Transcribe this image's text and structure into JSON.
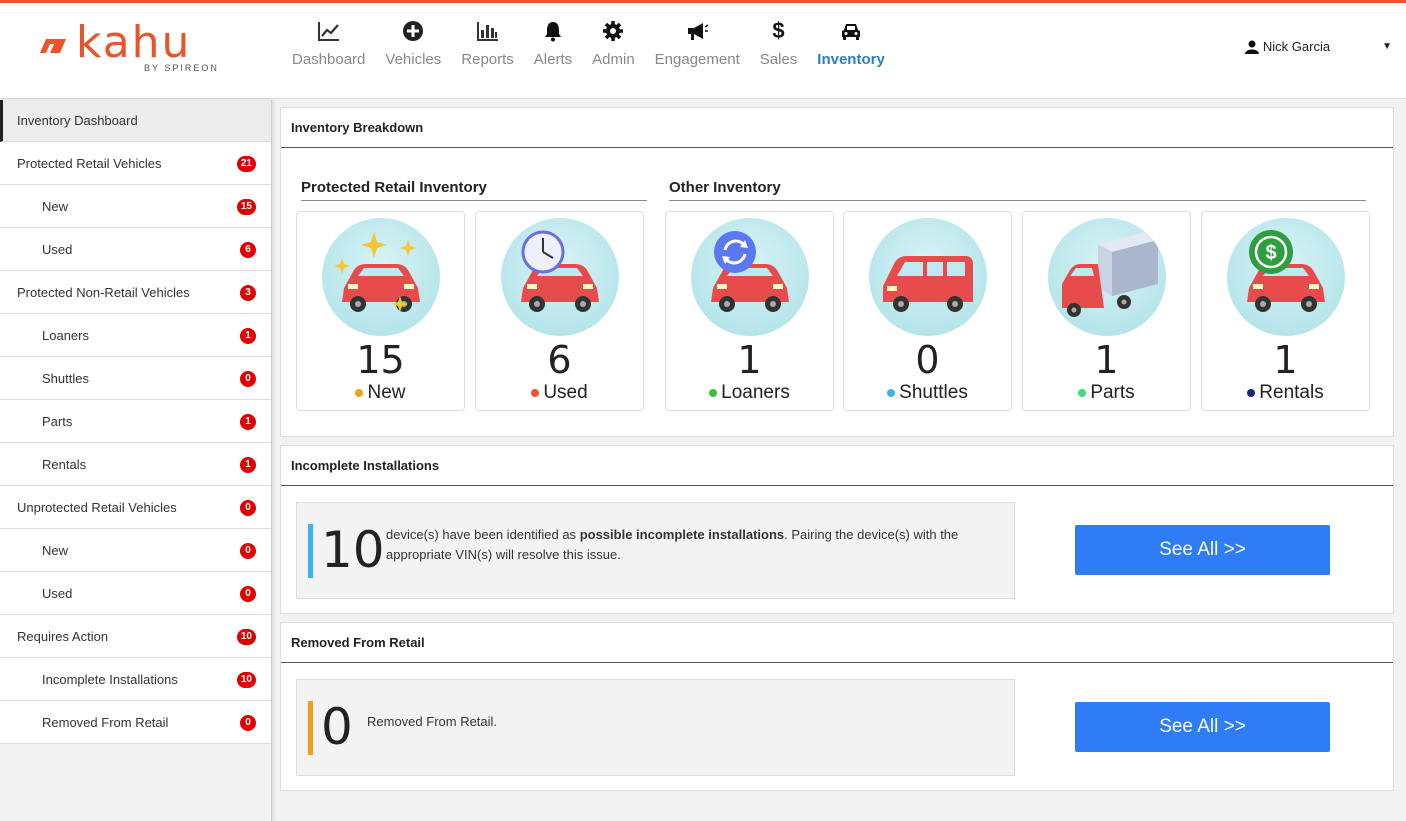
{
  "logo": {
    "word": "kahu",
    "by": "BY SPIREON"
  },
  "nav": [
    {
      "label": "Dashboard",
      "icon": "chart-line-icon"
    },
    {
      "label": "Vehicles",
      "icon": "plus-circle-icon"
    },
    {
      "label": "Reports",
      "icon": "bar-chart-icon"
    },
    {
      "label": "Alerts",
      "icon": "bell-icon"
    },
    {
      "label": "Admin",
      "icon": "gear-icon"
    },
    {
      "label": "Engagement",
      "icon": "megaphone-icon"
    },
    {
      "label": "Sales",
      "icon": "dollar-icon"
    },
    {
      "label": "Inventory",
      "icon": "car-icon",
      "active": true
    }
  ],
  "user": {
    "name": "Nick Garcia"
  },
  "sidebar": {
    "items": [
      {
        "label": "Inventory Dashboard",
        "badge": ""
      },
      {
        "label": "Protected Retail Vehicles",
        "badge": "21"
      },
      {
        "label": "New",
        "badge": "15"
      },
      {
        "label": "Used",
        "badge": "6"
      },
      {
        "label": "Protected Non-Retail Vehicles",
        "badge": "3"
      },
      {
        "label": "Loaners",
        "badge": "1"
      },
      {
        "label": "Shuttles",
        "badge": "0"
      },
      {
        "label": "Parts",
        "badge": "1"
      },
      {
        "label": "Rentals",
        "badge": "1"
      },
      {
        "label": "Unprotected Retail Vehicles",
        "badge": "0"
      },
      {
        "label": "New",
        "badge": "0"
      },
      {
        "label": "Used",
        "badge": "0"
      },
      {
        "label": "Requires Action",
        "badge": "10"
      },
      {
        "label": "Incomplete Installations",
        "badge": "10"
      },
      {
        "label": "Removed From Retail",
        "badge": "0"
      }
    ]
  },
  "breakdown": {
    "title": "Inventory Breakdown",
    "protected_title": "Protected Retail Inventory",
    "other_title": "Other Inventory",
    "cards": [
      {
        "count": "15",
        "label": "New",
        "dot": "#f0a020",
        "badge_icon": "sparkle-icon"
      },
      {
        "count": "6",
        "label": "Used",
        "dot": "#e8542b",
        "badge_icon": "clock-icon"
      },
      {
        "count": "1",
        "label": "Loaners",
        "dot": "#3cbf3c",
        "badge_icon": "refresh-icon"
      },
      {
        "count": "0",
        "label": "Shuttles",
        "dot": "#3cb4f0",
        "badge_icon": "van-icon"
      },
      {
        "count": "1",
        "label": "Parts",
        "dot": "#3cdc78",
        "badge_icon": "truck-icon"
      },
      {
        "count": "1",
        "label": "Rentals",
        "dot": "#1a237e",
        "badge_icon": "dollar-cycle-icon"
      }
    ]
  },
  "incomplete": {
    "title": "Incomplete Installations",
    "count": "10",
    "text_before": "device(s) have been identified as ",
    "text_bold": "possible incomplete installations",
    "text_after": ". Pairing the device(s) with the appropriate VIN(s) will resolve this issue.",
    "bar_color": "#3cb4f0",
    "button": "See All >>"
  },
  "removed": {
    "title": "Removed From Retail",
    "count": "0",
    "text": "Removed From Retail.",
    "bar_color": "#f0a020",
    "button": "See All >>"
  },
  "colors": {
    "accent": "#e8542b",
    "active_nav": "#2f7bc4",
    "button": "#2e7cf6",
    "badge": "#e00000"
  }
}
